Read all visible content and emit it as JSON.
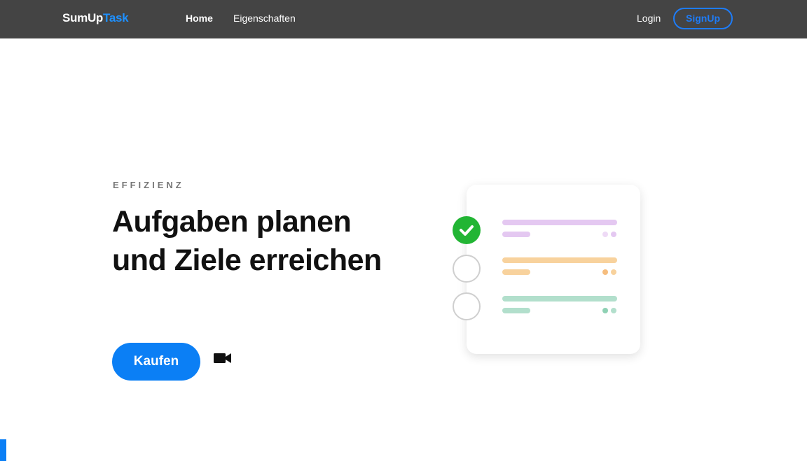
{
  "navbar": {
    "brand_part1": "SumUp",
    "brand_part2": "Task",
    "links": [
      "Home",
      "Eigenschaften"
    ],
    "login_label": "Login",
    "signup_label": "SignUp"
  },
  "hero": {
    "eyebrow": "EFFIZIENZ",
    "headline": "Aufgaben planen und Ziele erreichen",
    "buy_label": "Kaufen",
    "video_icon": "video-camera-icon"
  },
  "illustration": {
    "tasks": [
      {
        "status": "done",
        "color": "#e4c8f1"
      },
      {
        "status": "open",
        "color": "#f8d29d"
      },
      {
        "status": "open",
        "color": "#b2dfcc"
      }
    ]
  },
  "colors": {
    "navbar_bg": "#444444",
    "accent": "#0b7ff5",
    "done_green": "#22b534"
  }
}
